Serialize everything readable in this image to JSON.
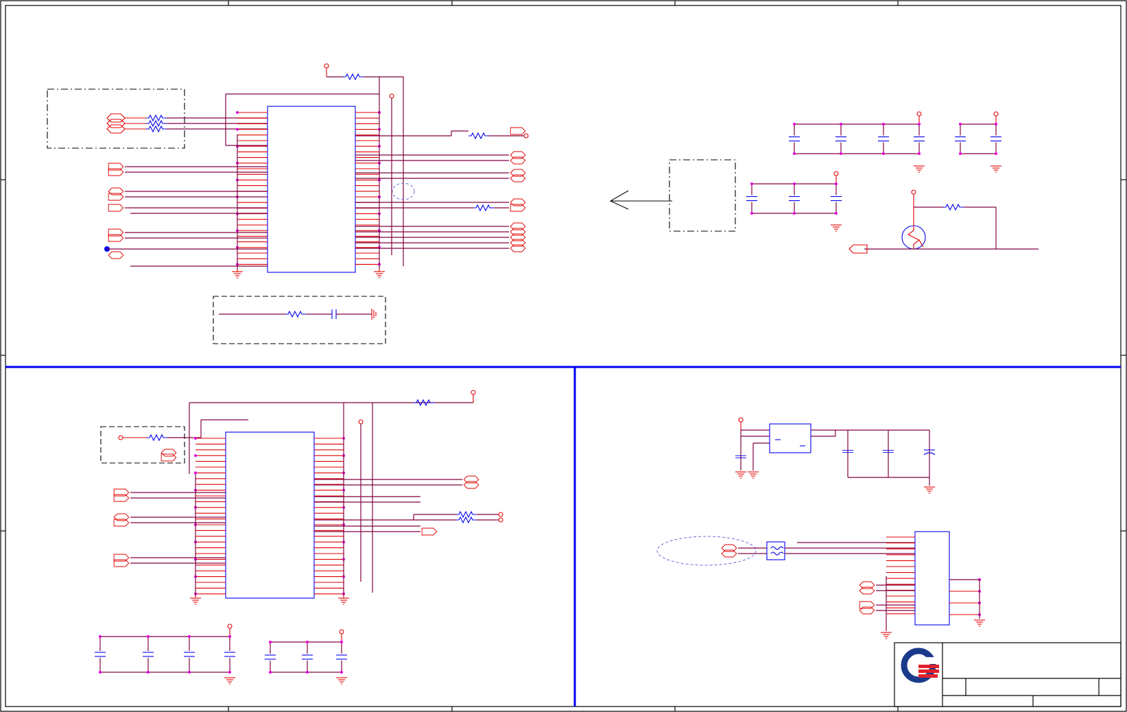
{
  "sheet": {
    "border_color": "#000000",
    "section_divider_color": "#0000ee",
    "wire_color": "#800040",
    "pin_color": "#e00000",
    "component_color": "#0000ee",
    "junction_color": "#e000e0"
  },
  "title_block": {
    "logo_icon": "company-logo-icon",
    "logo_colors": [
      "#1a3a8c",
      "#e0202a"
    ]
  }
}
